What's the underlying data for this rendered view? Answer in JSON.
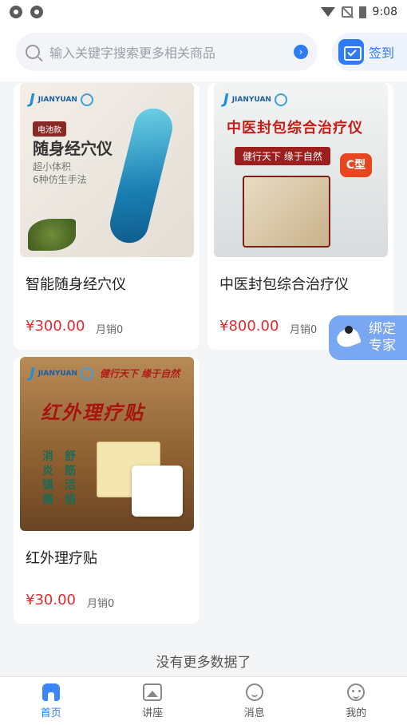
{
  "status_bar": {
    "time": "9:08"
  },
  "search": {
    "placeholder": "输入关键字搜索更多相关商品"
  },
  "signin": {
    "label": "签到"
  },
  "products": [
    {
      "title": "智能随身经穴仪",
      "price": "¥300.00",
      "sales": "月销0",
      "image": {
        "brand": "JIANYUAN",
        "tag": "电池款",
        "headline": "随身经穴仪",
        "line1": "超小体积",
        "line2": "6种仿生手法"
      }
    },
    {
      "title": "中医封包综合治疗仪",
      "price": "¥800.00",
      "sales": "月销0",
      "image": {
        "brand": "JIANYUAN",
        "headline": "中医封包综合治疗仪",
        "slogan": "健行天下 缘于自然",
        "badge": "C型"
      }
    },
    {
      "title": "红外理疗贴",
      "price": "¥30.00",
      "sales": "月销0",
      "image": {
        "brand": "JIANYUAN",
        "slogan": "健行天下 缘于自然",
        "headline": "红外理疗贴",
        "left_col": "消炎镇痛",
        "right_col": "舒筋活络"
      }
    }
  ],
  "floating": {
    "line1": "绑定",
    "line2": "专家"
  },
  "no_more": "没有更多数据了",
  "tabs": [
    {
      "label": "首页",
      "icon": "home-icon"
    },
    {
      "label": "讲座",
      "icon": "lecture-icon"
    },
    {
      "label": "消息",
      "icon": "message-icon"
    },
    {
      "label": "我的",
      "icon": "profile-icon"
    }
  ],
  "colors": {
    "accent": "#2e7bf6",
    "price": "#e02b2b"
  }
}
